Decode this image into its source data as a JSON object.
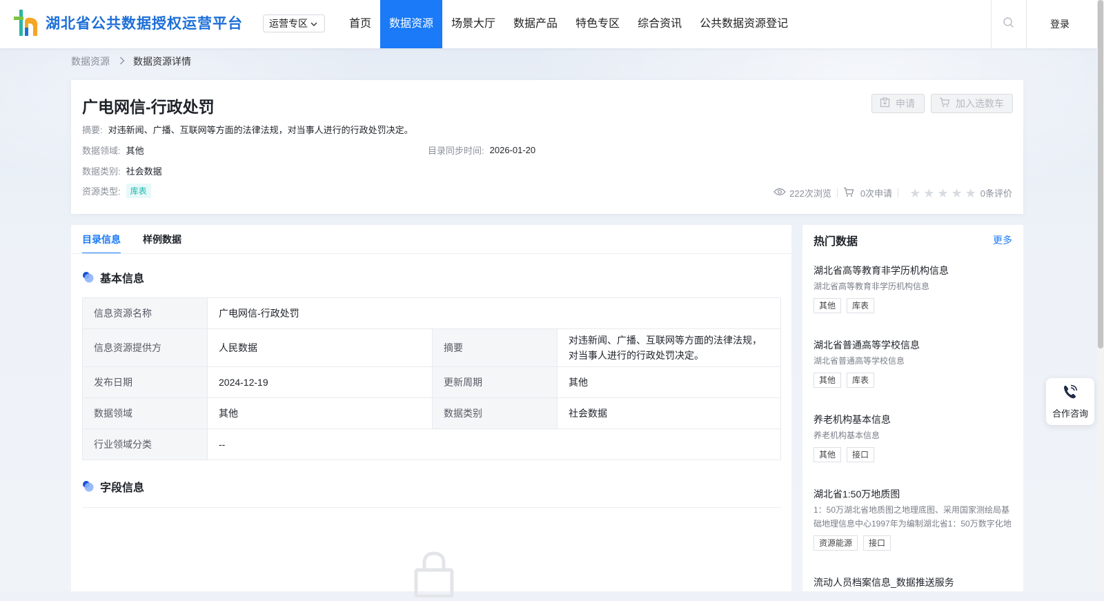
{
  "header": {
    "logo_text": "湖北省公共数据授权运营平台",
    "zone_select": "运营专区",
    "nav": [
      "首页",
      "数据资源",
      "场景大厅",
      "数据产品",
      "特色专区",
      "综合资讯",
      "公共数据资源登记"
    ],
    "active_nav": "数据资源",
    "login": "登录",
    "accent": "#1a7af8"
  },
  "breadcrumb": {
    "parent": "数据资源",
    "current": "数据资源详情"
  },
  "resource": {
    "title": "广电网信-行政处罚",
    "apply_label": "申请",
    "cart_label": "加入选数车",
    "summary_label": "摘要:",
    "summary": "对违新闻、广播、互联网等方面的法律法规，对当事人进行的行政处罚决定。",
    "domain_label": "数据领域:",
    "domain": "其他",
    "sync_label": "目录同步时间:",
    "sync_time": "2026-01-20",
    "category_label": "数据类别:",
    "category": "社会数据",
    "type_label": "资源类型:",
    "type": "库表",
    "views": "222次浏览",
    "applies": "0次申请",
    "reviews": "0条评价",
    "rating": 0
  },
  "tabs": [
    "目录信息",
    "样例数据"
  ],
  "basic_info": {
    "title": "基本信息",
    "rows": [
      {
        "l1": "信息资源名称",
        "v1": "广电网信-行政处罚"
      },
      {
        "l1": "信息资源提供方",
        "v1": "人民数据",
        "l2": "摘要",
        "v2": "对违新闻、广播、互联网等方面的法律法规，对当事人进行的行政处罚决定。"
      },
      {
        "l1": "发布日期",
        "v1": "2024-12-19",
        "l2": "更新周期",
        "v2": "其他"
      },
      {
        "l1": "数据领域",
        "v1": "其他",
        "l2": "数据类别",
        "v2": "社会数据"
      },
      {
        "l1": "行业领域分类",
        "v1": "--"
      }
    ]
  },
  "field_info": {
    "title": "字段信息"
  },
  "hot": {
    "title": "热门数据",
    "more": "更多",
    "items": [
      {
        "title": "湖北省高等教育非学历机构信息",
        "desc": "湖北省高等教育非学历机构信息",
        "tags": [
          "其他",
          "库表"
        ]
      },
      {
        "title": "湖北省普通高等学校信息",
        "desc": "湖北省普通高等学校信息",
        "tags": [
          "其他",
          "库表"
        ]
      },
      {
        "title": "养老机构基本信息",
        "desc": "养老机构基本信息",
        "tags": [
          "其他",
          "接口"
        ]
      },
      {
        "title": "湖北省1:50万地质图",
        "desc": "1：50万湖北省地质图之地理底图、采用国家测绘局基础地理信息中心1997年为编制湖北省1：50万数字化地",
        "tags": [
          "资源能源",
          "接口"
        ]
      },
      {
        "title": "流动人员档案信息_数据推送服务",
        "desc": "",
        "tags": []
      }
    ]
  },
  "consult": "合作咨询"
}
